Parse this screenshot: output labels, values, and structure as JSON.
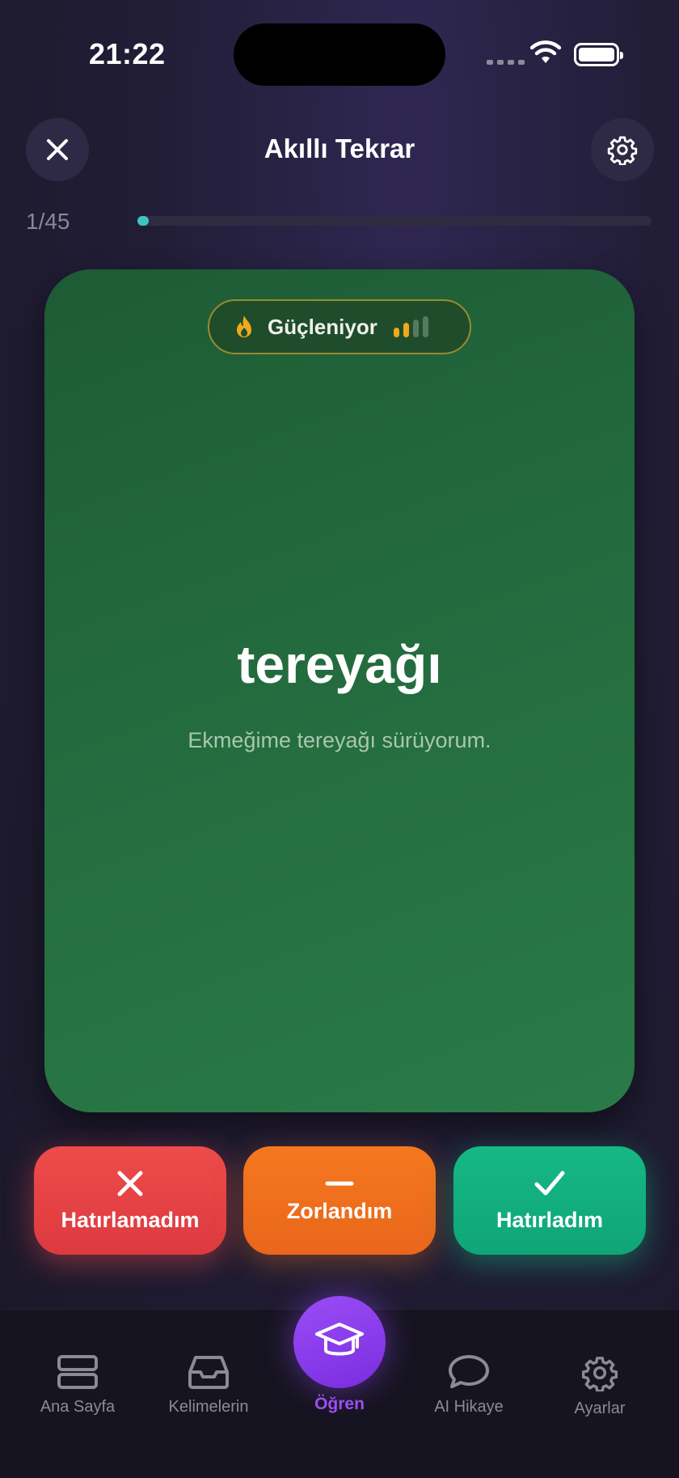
{
  "status_bar": {
    "time": "21:22"
  },
  "header": {
    "title": "Akıllı Tekrar",
    "close_icon": "close-icon",
    "settings_icon": "gear-icon"
  },
  "progress": {
    "current": 1,
    "total": 45,
    "label": "1/45",
    "fraction": 0.022,
    "accent": "#3ec5c0"
  },
  "card": {
    "badge": {
      "icon": "flame-icon",
      "label": "Güçleniyor",
      "level": 2,
      "max_level": 4,
      "accent": "#f0a81e"
    },
    "word": "tereyağı",
    "example": "Ekmeğime tereyağı sürüyorum.",
    "background": "#236b3e"
  },
  "answers": {
    "fail": {
      "label": "Hatırlamadım",
      "icon": "x-icon",
      "color": "#ee4b4b"
    },
    "hard": {
      "label": "Zorlandım",
      "icon": "minus-icon",
      "color": "#f5781f"
    },
    "ok": {
      "label": "Hatırladım",
      "icon": "check-icon",
      "color": "#16b885"
    }
  },
  "tabs": [
    {
      "label": "Ana Sayfa",
      "icon": "home-stack-icon"
    },
    {
      "label": "Kelimelerin",
      "icon": "inbox-icon"
    },
    {
      "label": "Öğren",
      "icon": "graduation-cap-icon",
      "active": true,
      "accent": "#9b4ff5"
    },
    {
      "label": "AI Hikaye",
      "icon": "chat-bubble-icon"
    },
    {
      "label": "Ayarlar",
      "icon": "gear-icon"
    }
  ]
}
